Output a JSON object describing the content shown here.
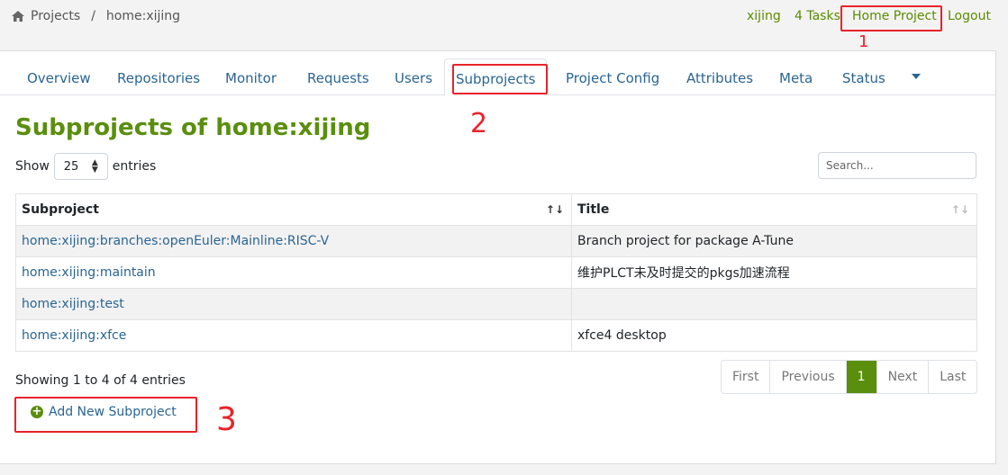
{
  "breadcrumb": {
    "root": "Projects",
    "separator": "/",
    "current": "home:xijing"
  },
  "topnav": {
    "user": "xijing",
    "tasks": "4 Tasks",
    "home_project": "Home Project",
    "logout": "Logout"
  },
  "tabs": [
    {
      "label": "Overview"
    },
    {
      "label": "Repositories"
    },
    {
      "label": "Monitor"
    },
    {
      "label": "Requests"
    },
    {
      "label": "Users"
    },
    {
      "label": "Subprojects"
    },
    {
      "label": "Project Config"
    },
    {
      "label": "Attributes"
    },
    {
      "label": "Meta"
    },
    {
      "label": "Status"
    }
  ],
  "page_title": "Subprojects of home:xijing",
  "length": {
    "show": "Show",
    "value": "25",
    "entries": "entries"
  },
  "search": {
    "placeholder": "Search..."
  },
  "table": {
    "headers": [
      "Subproject",
      "Title"
    ],
    "rows": [
      {
        "subproject": "home:xijing:branches:openEuler:Mainline:RISC-V",
        "title": "Branch project for package A-Tune"
      },
      {
        "subproject": "home:xijing:maintain",
        "title": "维护PLCT未及时提交的pkgs加速流程"
      },
      {
        "subproject": "home:xijing:test",
        "title": ""
      },
      {
        "subproject": "home:xijing:xfce",
        "title": "xfce4 desktop"
      }
    ]
  },
  "info": "Showing 1 to 4 of 4 entries",
  "pagination": {
    "first": "First",
    "previous": "Previous",
    "current": "1",
    "next": "Next",
    "last": "Last"
  },
  "add_button": "Add New Subproject",
  "annotations": {
    "one": "1",
    "two": "2",
    "three": "3"
  },
  "colors": {
    "accent": "#5a8f0e",
    "link": "#2a6592",
    "annotation": "#e8232a"
  }
}
